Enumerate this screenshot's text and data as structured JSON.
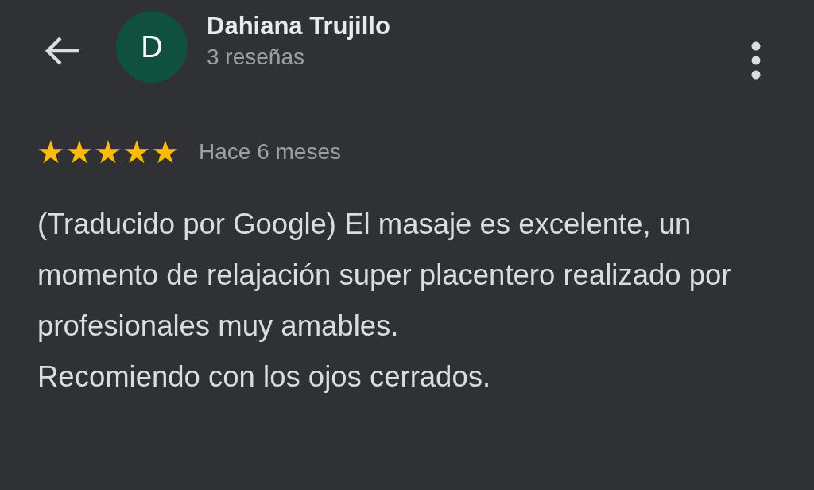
{
  "reviewer": {
    "initial": "D",
    "name": "Dahiana Trujillo",
    "reviews": "3 reseñas"
  },
  "review": {
    "stars": 5,
    "time": "Hace 6 meses",
    "paragraphs": [
      "(Traducido por Google) El masaje es excelente, un momento de relajación super placentero realizado por profesionales muy amables.",
      "Recomiendo con los ojos cerrados."
    ]
  }
}
